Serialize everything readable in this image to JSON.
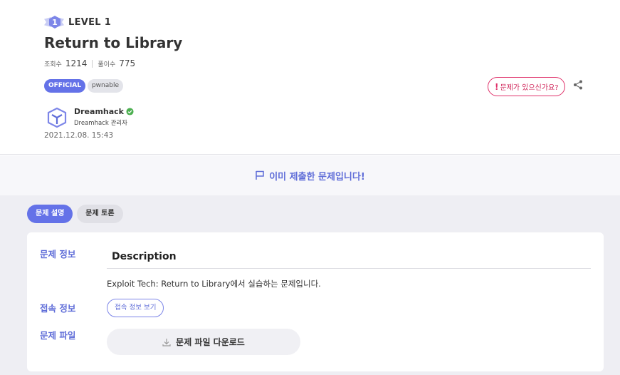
{
  "challenge": {
    "level_label": "LEVEL 1",
    "level_number": "1",
    "title": "Return to Library",
    "views_label": "조회수",
    "views": "1214",
    "solves_label": "풀이수",
    "solves": "775",
    "tags": [
      "OFFICIAL",
      "pwnable"
    ],
    "report_label": "문제가 있으신가요?",
    "author_name": "Dreamhack",
    "author_role": "Dreamhack 관리자",
    "date": "2021.12.08. 15:43"
  },
  "solved_banner": "이미 제출한 문제입니다!",
  "tabs": [
    "문제 설명",
    "문제 토론"
  ],
  "card": {
    "info_label": "문제 정보",
    "access_label": "접속 정보",
    "file_label": "문제 파일",
    "description_heading": "Description",
    "description_text": "Exploit Tech: Return to Library에서 실습하는 문제입니다.",
    "access_button": "접속 정보 보기",
    "download_button": "문제 파일 다운로드"
  },
  "colors": {
    "accent": "#6472e8",
    "report": "#e0336b",
    "verified": "#4caf50"
  }
}
